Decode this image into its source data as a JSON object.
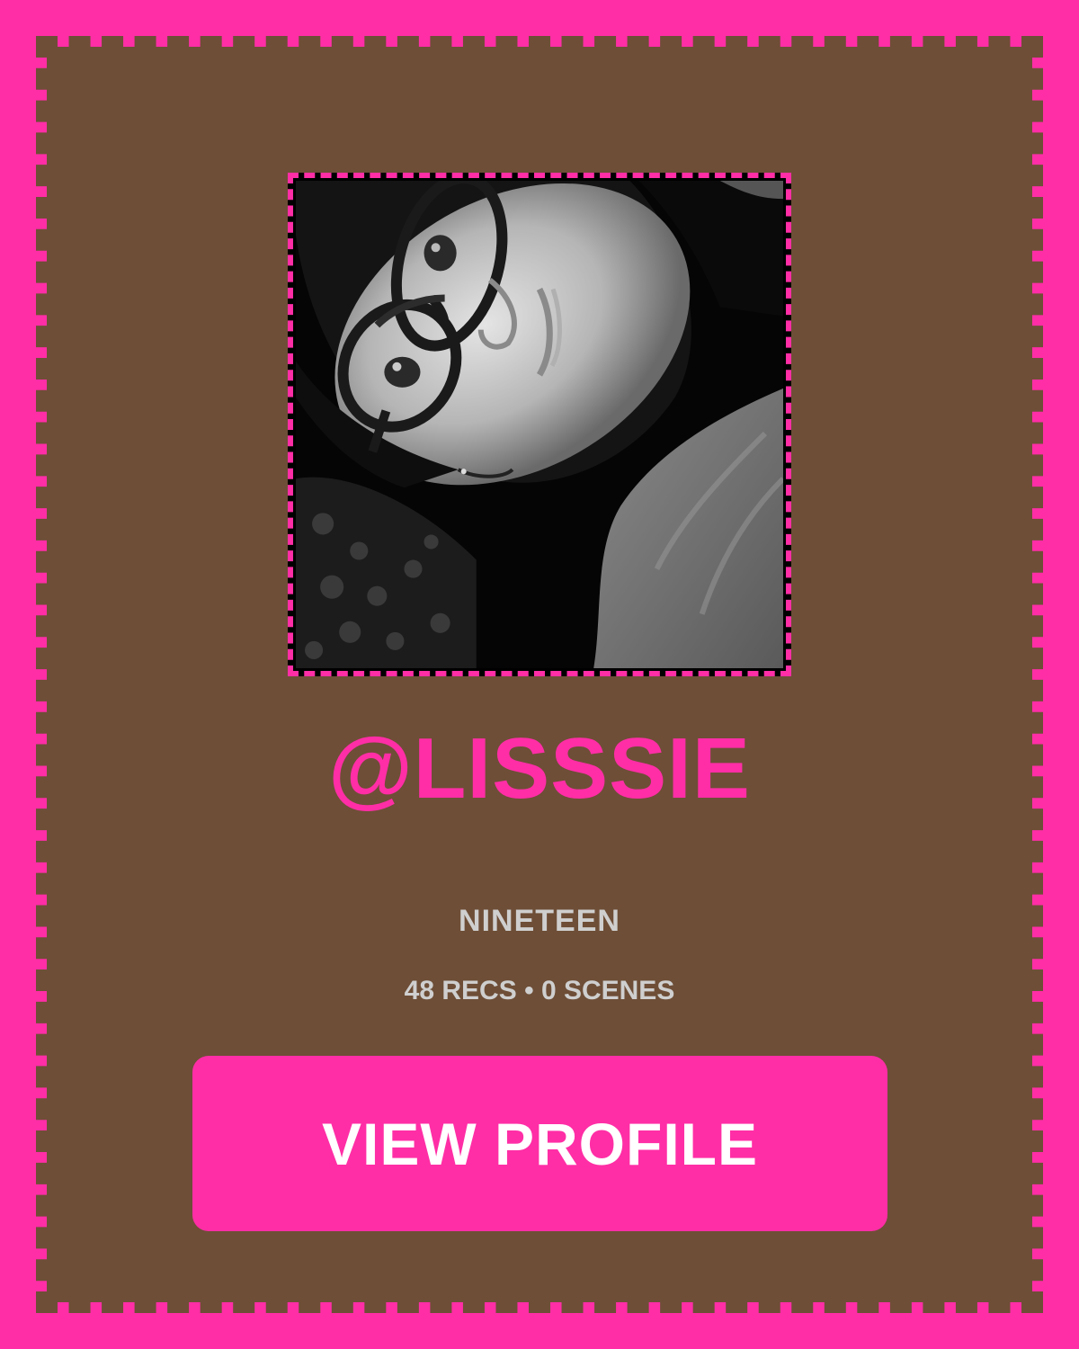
{
  "profile": {
    "username": "@LISSSIE",
    "bio": "NINETEEN",
    "recs": "48 RECS",
    "separator": "•",
    "scenes": "0 SCENES",
    "view_button_label": "VIEW PROFILE",
    "avatar_icon": "profile-photo"
  },
  "colors": {
    "accent": "#ff2ea6",
    "card_background": "#6e4e37",
    "muted_text": "#cfcfcf"
  }
}
